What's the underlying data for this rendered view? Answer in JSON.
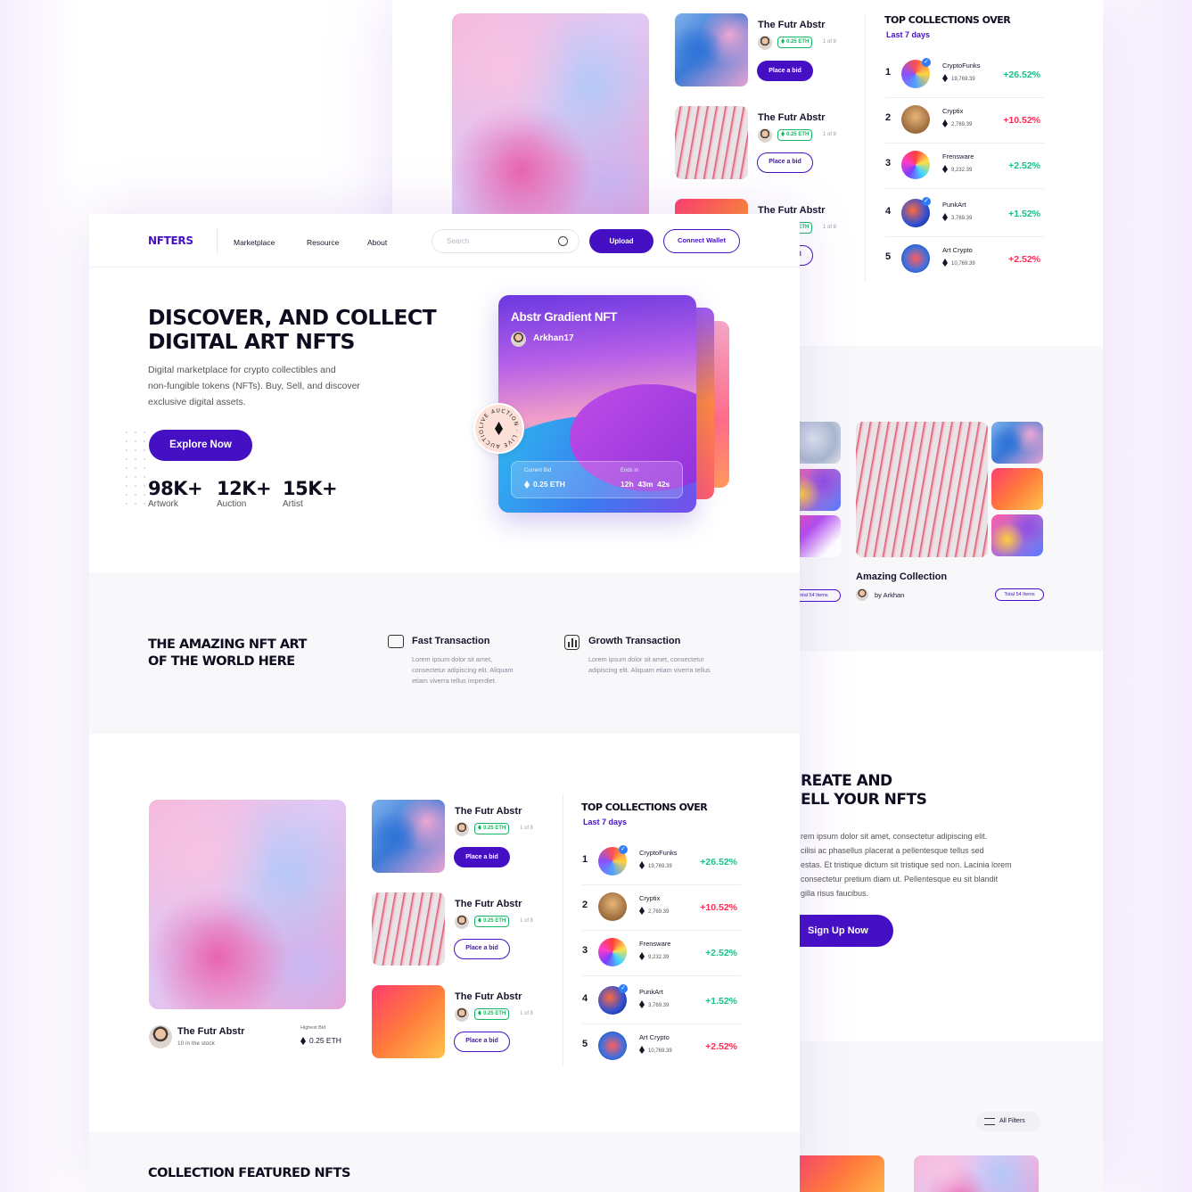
{
  "brand": "NFTERS",
  "nav": {
    "links": [
      "Marketplace",
      "Resource",
      "About"
    ],
    "search_placeholder": "Search",
    "upload": "Upload",
    "connect": "Connect Wallet"
  },
  "hero": {
    "title_line1": "DISCOVER, AND COLLECT",
    "title_line2": "DIGITAL ART  NFTS",
    "description_lines": [
      "Digital marketplace for crypto collectibles and",
      "non-fungible tokens (NFTs). Buy, Sell, and discover",
      "exclusive digital assets."
    ],
    "cta": "Explore Now",
    "stats": [
      {
        "value": "98K+",
        "label": "Artwork"
      },
      {
        "value": "12K+",
        "label": "Auction"
      },
      {
        "value": "15K+",
        "label": "Artist"
      }
    ],
    "card": {
      "title": "Abstr Gradient NFT",
      "owner": "Arkhan17",
      "current_bid_label": "Current Bid",
      "current_bid": "0.25 ETH",
      "ends_label": "Ends in",
      "ends": "12h  43m  42s",
      "badge": "LIVE AUCTION · LIVE AUCTION ·"
    }
  },
  "features": {
    "title_line1": "THE AMAZING NFT ART",
    "title_line2": "OF THE WORLD HERE",
    "items": [
      {
        "icon": "card-check-icon",
        "title": "Fast Transaction",
        "text_lines": [
          "Lorem ipsum dolor sit amet,",
          "consectetur adipiscing elit. Aliquam",
          "etiam viverra tellus imperdiet."
        ]
      },
      {
        "icon": "chart-icon",
        "title": "Growth Transaction",
        "text_lines": [
          "Lorem ipsum dolor sit amet, consectetur",
          "adipiscing elit. Aliquam etiam viverra tellus"
        ]
      }
    ]
  },
  "featured": {
    "name": "The Futr Abstr",
    "stock": "10 in the stock",
    "highest_bid_label": "Highest Bid",
    "highest_bid": "0.25 ETH"
  },
  "listings": [
    {
      "title": "The Futr Abstr",
      "price": "0.25 ETH",
      "count": "1 of 8",
      "button": "Place a bid",
      "primary": true
    },
    {
      "title": "The Futr Abstr",
      "price": "0.25 ETH",
      "count": "1 of 8",
      "button": "Place a bid",
      "primary": false
    },
    {
      "title": "The Futr Abstr",
      "price": "0.25 ETH",
      "count": "1 of 8",
      "button": "Place a bid",
      "primary": false
    }
  ],
  "top_collections": {
    "title": "TOP COLLECTIONS OVER",
    "subtitle": "Last 7 days",
    "items": [
      {
        "rank": "1",
        "name": "CryptoFunks",
        "value": "19,769.39",
        "change": "+26.52%",
        "trend": "up",
        "verified": true
      },
      {
        "rank": "2",
        "name": "Cryptix",
        "value": "2,769.39",
        "change": "+10.52%",
        "trend": "down",
        "verified": false
      },
      {
        "rank": "3",
        "name": "Frensware",
        "value": "9,232.39",
        "change": "+2.52%",
        "trend": "up",
        "verified": false
      },
      {
        "rank": "4",
        "name": "PunkArt",
        "value": "3,769.39",
        "change": "+1.52%",
        "trend": "up",
        "verified": true
      },
      {
        "rank": "5",
        "name": "Art Crypto",
        "value": "10,769.39",
        "change": "+2.52%",
        "trend": "down",
        "verified": false
      }
    ]
  },
  "collection": {
    "name": "Amazing Collection",
    "by": "by Arkhan",
    "total": "Total 54 Items"
  },
  "create": {
    "title_line1": "REATE AND",
    "title_line2": "ELL YOUR NFTS",
    "text_lines": [
      "rem ipsum dolor sit amet, consectetur adipiscing elit.",
      "cilisi ac phasellus placerat a pellentesque tellus sed",
      "estas. Et tristique dictum sit tristique sed non. Lacinia lorem",
      "consectetur pretium diam ut. Pellentesque eu sit blandit",
      "gilla risus faucibus."
    ],
    "cta": "Sign Up Now"
  },
  "filters": "All Filters",
  "featured_section_title": "COLLECTION FEATURED NFTS",
  "colors": {
    "primary": "#4510c4",
    "up": "#19c08b",
    "down": "#ff2b55"
  }
}
